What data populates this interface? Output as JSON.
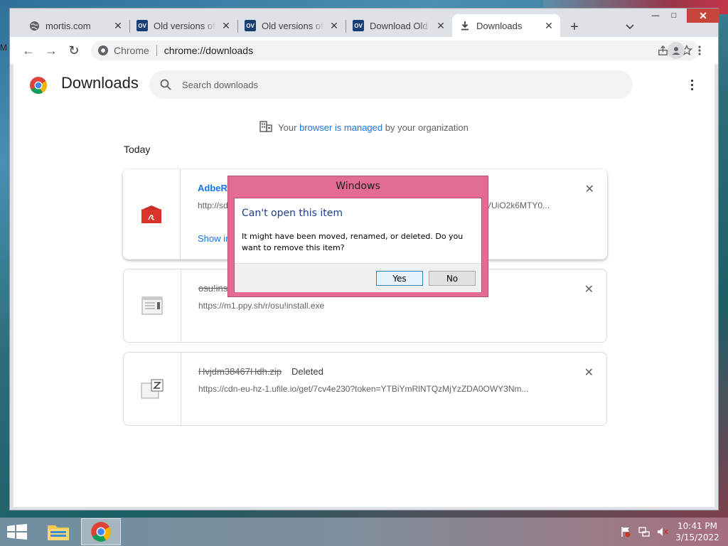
{
  "desktop": {
    "partial_label": "M"
  },
  "window": {
    "min": "—",
    "max": "□",
    "close": "✕"
  },
  "tabs": [
    {
      "title": "mortis.com",
      "icon": "globe-icon",
      "active": false
    },
    {
      "title": "Old versions of",
      "icon": "ov-favicon",
      "active": false
    },
    {
      "title": "Old versions of",
      "icon": "ov-favicon",
      "active": false
    },
    {
      "title": "Download Old",
      "icon": "ov-favicon",
      "active": false
    },
    {
      "title": "Downloads",
      "icon": "download-icon",
      "active": true
    }
  ],
  "ov_badge": "OV",
  "new_tab": "+",
  "tab_search": "⌄",
  "toolbar": {
    "back": "←",
    "forward": "→",
    "reload": "↻"
  },
  "omnibox": {
    "site": "Chrome",
    "url": "chrome://downloads"
  },
  "page": {
    "title": "Downloads",
    "search_placeholder": "Search downloads",
    "managed_prefix": "Your ",
    "managed_link": "browser is managed",
    "managed_suffix": " by your organization",
    "day": "Today"
  },
  "downloads": [
    {
      "name": "AdbeRd",
      "url": "http://sd",
      "url_end": "VUiO2k6MTY0...",
      "action": "Show in",
      "status": ""
    },
    {
      "name": "osu!inst",
      "url": "https://m1.ppy.sh/r/osu!install.exe",
      "status": ""
    },
    {
      "name": "Hvjdm38467Hdh.zip",
      "url": "https://cdn-eu-hz-1.ufile.io/get/7cv4e230?token=YTBiYmRlNTQzMjYzZDA0OWY3Nm...",
      "status": "Deleted"
    }
  ],
  "dialog": {
    "title": "Windows",
    "heading": "Can't open this item",
    "message": "It might have been moved, renamed, or deleted. Do you want to remove this item?",
    "yes": "Yes",
    "no": "No"
  },
  "taskbar": {
    "time": "10:41 PM",
    "date": "3/15/2022"
  },
  "colors": {
    "accent": "#1a73e8",
    "dialog_frame": "#e36b96",
    "close_red": "#c7443c"
  }
}
